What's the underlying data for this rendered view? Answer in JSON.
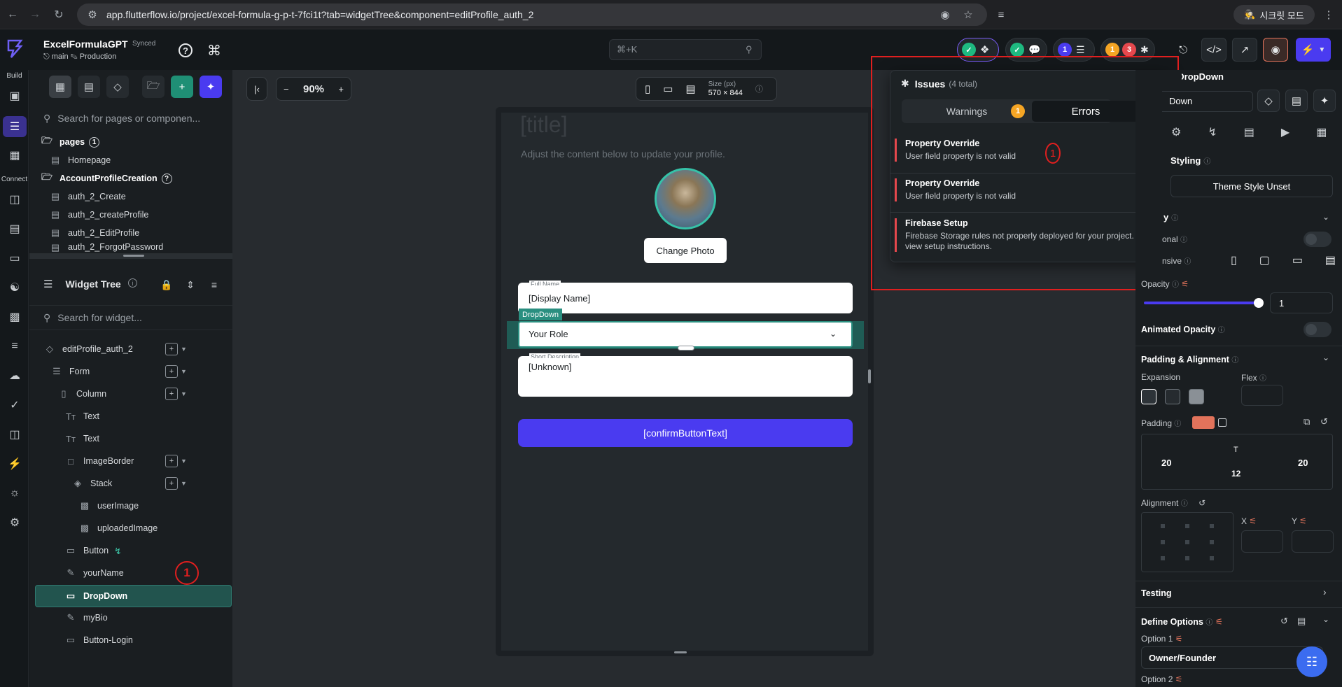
{
  "browser": {
    "url": "app.flutterflow.io/project/excel-formula-g-p-t-7fci1t?tab=widgetTree&component=editProfile_auth_2",
    "profile": "시크릿 모드"
  },
  "header": {
    "project_name": "ExcelFormulaGPT",
    "synced": "Synced",
    "branch": "main",
    "environment": "Production",
    "search_placeholder": "⌘+K",
    "badge_blue": "1",
    "badge_orange": "1",
    "badge_red": "3"
  },
  "rail": {
    "build_label": "Build",
    "connect_label": "Connect"
  },
  "nav": {
    "search_placeholder": "Search for pages or componen...",
    "pages_label": "pages",
    "pages_count": "1",
    "homepage": "Homepage",
    "folder": "AccountProfileCreation",
    "items": [
      "auth_2_Create",
      "auth_2_createProfile",
      "auth_2_EditProfile",
      "auth_2_ForgotPassword"
    ]
  },
  "widget_tree": {
    "title": "Widget Tree",
    "search_placeholder": "Search for widget...",
    "nodes": [
      {
        "label": "editProfile_auth_2"
      },
      {
        "label": "Form"
      },
      {
        "label": "Column"
      },
      {
        "label": "Text"
      },
      {
        "label": "Text"
      },
      {
        "label": "ImageBorder"
      },
      {
        "label": "Stack"
      },
      {
        "label": "userImage"
      },
      {
        "label": "uploadedImage"
      },
      {
        "label": "Button"
      },
      {
        "label": "yourName"
      },
      {
        "label": "DropDown"
      },
      {
        "label": "myBio"
      },
      {
        "label": "Button-Login"
      }
    ],
    "annotation": "1"
  },
  "canvas": {
    "zoom": "90%",
    "size_label": "Size (px)",
    "size_value": "570 × 844",
    "title_text": "[title]",
    "subtitle_text": "Adjust the content below to update your profile.",
    "change_photo": "Change Photo",
    "full_name_label": "Full Name",
    "full_name_value": "[Display Name]",
    "dropdown_tag": "DropDown",
    "dropdown_value": "Your Role",
    "short_desc_label": "Short Description",
    "short_desc_value": "[Unknown]",
    "confirm_button": "[confirmButtonText]"
  },
  "issues": {
    "title": "Issues",
    "total": "(4 total)",
    "warnings_tab": "Warnings",
    "warnings_count": "1",
    "errors_tab": "Errors",
    "errors_count": "3",
    "annotation": "1",
    "items": [
      {
        "title": "Property Override",
        "desc": "User field property is not valid"
      },
      {
        "title": "Property Override",
        "desc": "User field property is not valid"
      },
      {
        "title": "Firebase Setup",
        "desc": "Firebase Storage rules not properly deployed for your project. Tap to view setup instructions."
      }
    ]
  },
  "properties": {
    "widget_type": "DropDown",
    "widget_name": "Down",
    "styling_label": "Styling",
    "theme_style": "Theme Style Unset",
    "visibility_header": "y",
    "conditional_label": "onal",
    "responsive_label": "nsive",
    "opacity_label": "Opacity",
    "opacity_value": "1",
    "animated_opacity": "Animated Opacity",
    "padding_alignment": "Padding & Alignment",
    "expansion": "Expansion",
    "flex": "Flex",
    "padding": "Padding",
    "pad_top": "T",
    "pad_left": "20",
    "pad_right": "20",
    "pad_bottom": "12",
    "alignment": "Alignment",
    "x_label": "X",
    "y_label": "Y",
    "testing": "Testing",
    "define_options": "Define Options",
    "option1_label": "Option 1",
    "option1_value": "Owner/Founder",
    "option2_label": "Option 2"
  },
  "colors": {
    "accent": "#5b3cf5",
    "teal": "#1f6f66",
    "error": "#e5484d",
    "warning": "#f5a524",
    "annotation": "#e01f1f"
  }
}
